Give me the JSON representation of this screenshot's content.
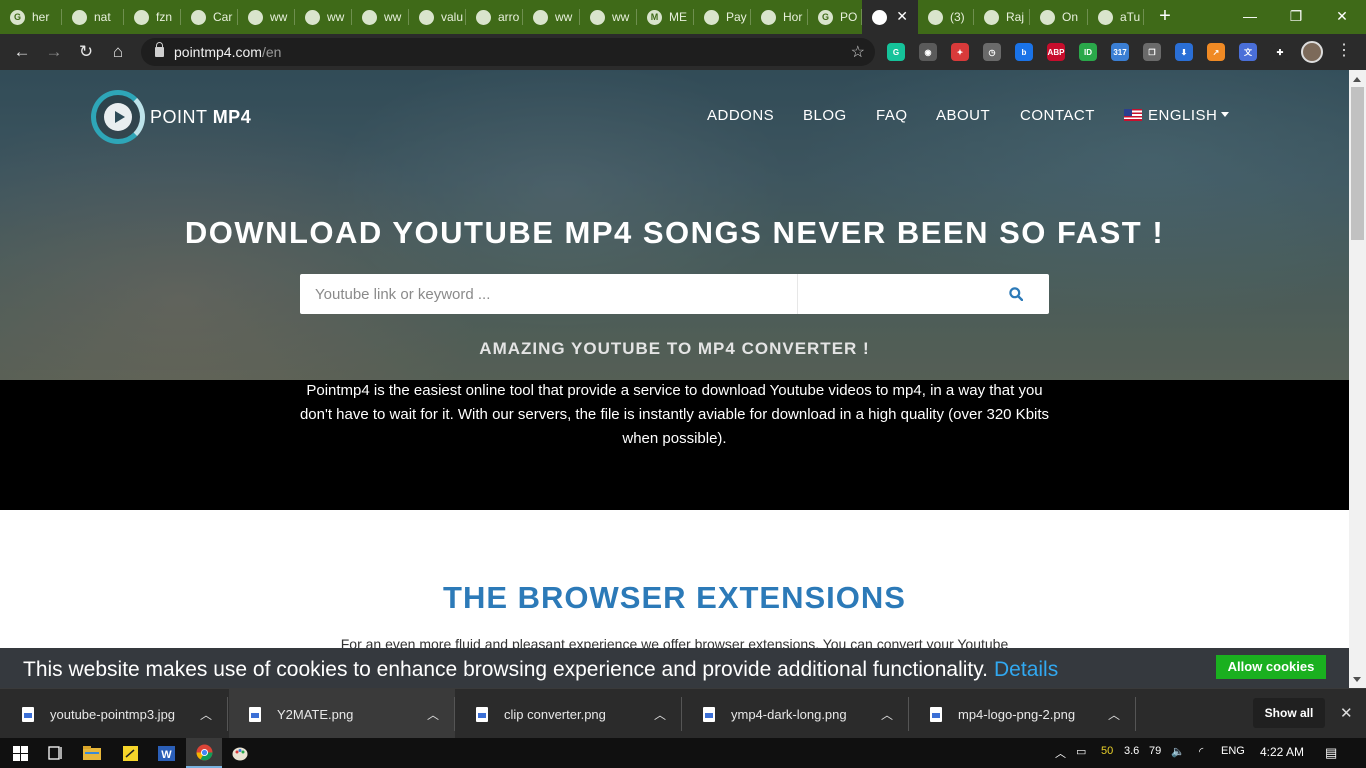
{
  "browser": {
    "tabs": [
      {
        "label": "her",
        "icon": "google-g-icon"
      },
      {
        "label": "nat",
        "icon": "globe-icon"
      },
      {
        "label": "fzn",
        "icon": "globe-icon"
      },
      {
        "label": "Car",
        "icon": "globe-icon"
      },
      {
        "label": "ww",
        "icon": "globe-icon"
      },
      {
        "label": "ww",
        "icon": "globe-icon"
      },
      {
        "label": "ww",
        "icon": "globe-icon"
      },
      {
        "label": "valu",
        "icon": "globe-icon"
      },
      {
        "label": "arro",
        "icon": "globe-icon"
      },
      {
        "label": "ww",
        "icon": "globe-icon"
      },
      {
        "label": "ww",
        "icon": "globe-icon"
      },
      {
        "label": "ME",
        "icon": "m-logo-icon"
      },
      {
        "label": "Pay",
        "icon": "paypal-icon"
      },
      {
        "label": "Hor",
        "icon": "nd-logo-icon"
      },
      {
        "label": "PO",
        "icon": "google-g-icon"
      },
      {
        "label": "",
        "icon": "pointmp4-icon"
      },
      {
        "label": "(3)",
        "icon": "palm-icon"
      },
      {
        "label": "Raj",
        "icon": "palm-icon"
      },
      {
        "label": "On",
        "icon": "blank-icon"
      },
      {
        "label": "aTu",
        "icon": "fox-icon"
      }
    ],
    "url_host": "pointmp4.com",
    "url_path": "/en",
    "extensions": [
      {
        "name": "grammarly-icon",
        "glyph": "G",
        "color": "#15c39a"
      },
      {
        "name": "bulb-icon",
        "glyph": "◉",
        "color": "#5a5a5a"
      },
      {
        "name": "pin-icon",
        "glyph": "✦",
        "color": "#d83a3a"
      },
      {
        "name": "clock-ext-icon",
        "glyph": "◷",
        "color": "#6a6a6a"
      },
      {
        "name": "bing-icon",
        "glyph": "b",
        "color": "#1a73e8"
      },
      {
        "name": "adblock-plus-icon",
        "glyph": "ABP",
        "color": "#c70d2c"
      },
      {
        "name": "id-ext-icon",
        "glyph": "ID",
        "color": "#2aa84a"
      },
      {
        "name": "calendar-ext-icon",
        "glyph": "317",
        "color": "#3b7fd4"
      },
      {
        "name": "tabs-ext-icon",
        "glyph": "❐",
        "color": "#6a6a6a"
      },
      {
        "name": "download-ext-icon",
        "glyph": "⬇",
        "color": "#2a6fd6"
      },
      {
        "name": "chart-ext-icon",
        "glyph": "↗",
        "color": "#f08a24"
      },
      {
        "name": "translate-ext-icon",
        "glyph": "文",
        "color": "#4a6fd8"
      },
      {
        "name": "puzzle-icon",
        "glyph": "✚",
        "color": "#2b2b2b"
      }
    ]
  },
  "site": {
    "logo_text_light": "POINT ",
    "logo_text_bold": "MP4",
    "nav": {
      "addons": "ADDONS",
      "blog": "BLOG",
      "faq": "FAQ",
      "about": "ABOUT",
      "contact": "CONTACT",
      "language": "ENGLISH"
    },
    "headline": "DOWNLOAD YOUTUBE MP4 SONGS NEVER BEEN SO FAST !",
    "search_placeholder": "Youtube link or keyword ...",
    "subhead": "AMAZING YOUTUBE TO MP4 CONVERTER !",
    "intro": "Pointmp4 is the easiest online tool that provide a service to download Youtube videos to mp4, in a way that you don't have to wait for it. With our servers, the file is instantly aviable for download in a high quality (over 320 Kbits when possible).",
    "extensions_title": "THE BROWSER EXTENSIONS",
    "extensions_text": "For an even more fluid and pleasant experience we offer browser extensions. You can convert your Youtube",
    "cookie_text": "This website makes use of cookies to enhance browsing experience and provide additional functionality.",
    "cookie_details": "Details",
    "cookie_allow": "Allow cookies"
  },
  "downloads": {
    "items": [
      "youtube-pointmp3.jpg",
      "Y2MATE.png",
      "clip converter.png",
      "ymp4-dark-long.png",
      "mp4-logo-png-2.png"
    ],
    "show_all": "Show all"
  },
  "taskbar": {
    "battery_percent": "50",
    "tray_num": "3.6",
    "volume_num": "79",
    "language": "ENG",
    "time": "4:22 AM"
  },
  "colors": {
    "tabstrip": "#3f6a18",
    "accent_blue": "#2c7ab8",
    "allow_green": "#1ab01f",
    "details_link": "#31a8f0"
  }
}
